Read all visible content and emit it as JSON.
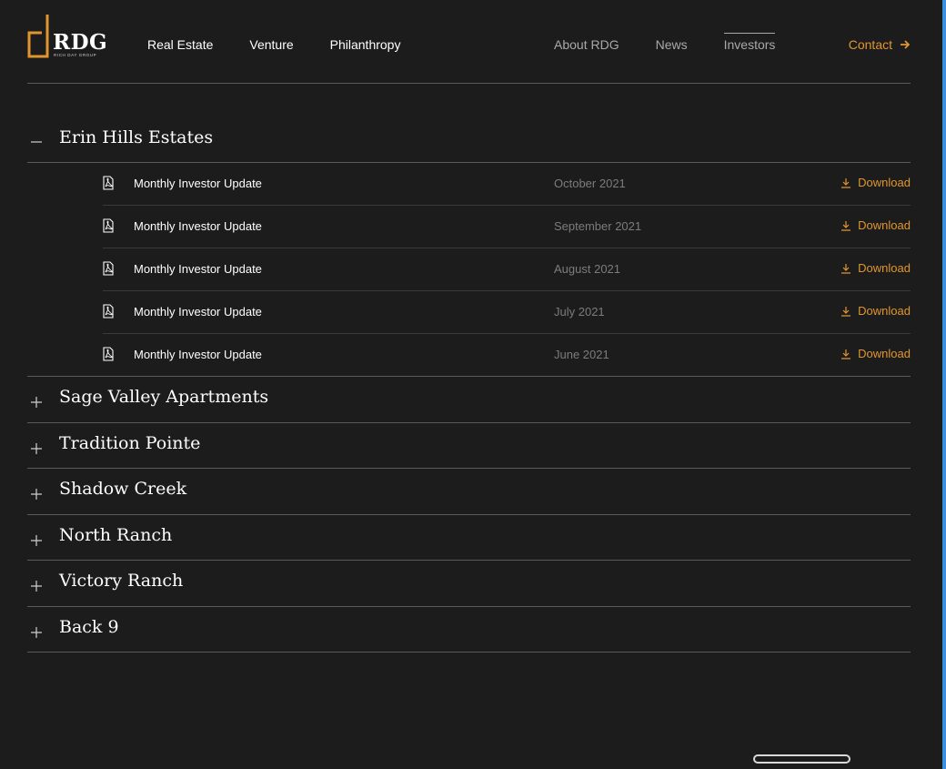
{
  "brand": {
    "name": "RDG",
    "tagline": "RICH DAY GROUP",
    "accent_color": "#e0962f"
  },
  "nav": {
    "primary": [
      "Real Estate",
      "Venture",
      "Philanthropy"
    ],
    "secondary": [
      "About RDG",
      "News",
      "Investors"
    ],
    "active": "Investors",
    "contact_label": "Contact"
  },
  "properties": {
    "expanded": {
      "title": "Erin Hills Estates",
      "documents": [
        {
          "title": "Monthly Investor Update",
          "date": "October 2021",
          "action": "Download"
        },
        {
          "title": "Monthly Investor Update",
          "date": "September 2021",
          "action": "Download"
        },
        {
          "title": "Monthly Investor Update",
          "date": "August 2021",
          "action": "Download"
        },
        {
          "title": "Monthly Investor Update",
          "date": "July 2021",
          "action": "Download"
        },
        {
          "title": "Monthly Investor Update",
          "date": "June 2021",
          "action": "Download"
        }
      ]
    },
    "collapsed": [
      "Sage Valley Apartments",
      "Tradition Pointe",
      "Shadow Creek",
      "North Ranch",
      "Victory Ranch",
      "Back 9"
    ]
  },
  "icons": {
    "expanded_toggle": "minus-icon",
    "collapsed_toggle": "plus-icon",
    "document": "pdf-icon",
    "download": "download-icon",
    "contact": "arrow-right-icon"
  }
}
